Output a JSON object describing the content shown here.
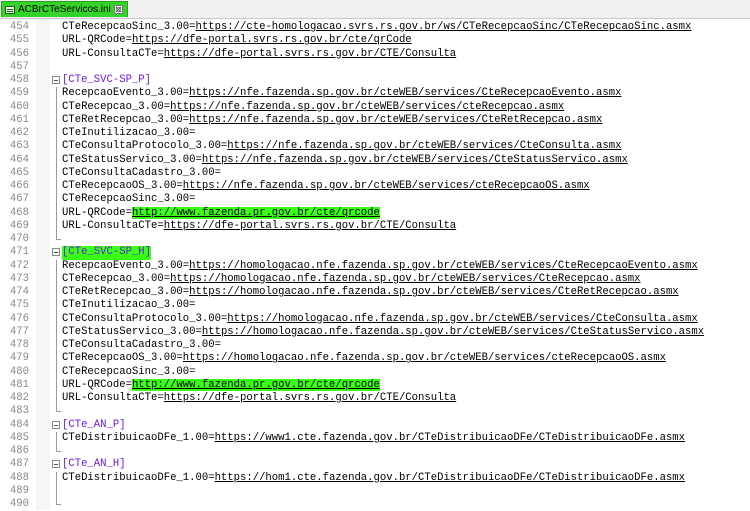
{
  "tab": {
    "title": "ACBrCTeServicos.ini",
    "close_glyph": "⊠"
  },
  "lines": [
    {
      "n": "454",
      "key": "CTeRecepcaoSinc_3.00=",
      "url": "https://cte-homologacao.svrs.rs.gov.br/ws/CTeRecepcaoSinc/CTeRecepcaoSinc.asmx"
    },
    {
      "n": "455",
      "key": "URL-QRCode=",
      "url": "https://dfe-portal.svrs.rs.gov.br/cte/qrCode"
    },
    {
      "n": "456",
      "key": "URL-ConsultaCTe=",
      "url": "https://dfe-portal.svrs.rs.gov.br/CTE/Consulta"
    },
    {
      "n": "457",
      "key": "",
      "url": ""
    },
    {
      "n": "458",
      "section": "[CTe_SVC-SP_P]",
      "fold": "start"
    },
    {
      "n": "459",
      "key": "RecepcaoEvento_3.00=",
      "url": "https://nfe.fazenda.sp.gov.br/cteWEB/services/CteRecepcaoEvento.asmx"
    },
    {
      "n": "460",
      "key": "CTeRecepcao_3.00=",
      "url": "https://nfe.fazenda.sp.gov.br/cteWEB/services/cteRecepcao.asmx"
    },
    {
      "n": "461",
      "key": "CTeRetRecepcao_3.00=",
      "url": "https://nfe.fazenda.sp.gov.br/cteWEB/services/CteRetRecepcao.asmx"
    },
    {
      "n": "462",
      "key": "CTeInutilizacao_3.00=",
      "url": ""
    },
    {
      "n": "463",
      "key": "CTeConsultaProtocolo_3.00=",
      "url": "https://nfe.fazenda.sp.gov.br/cteWEB/services/CteConsulta.asmx"
    },
    {
      "n": "464",
      "key": "CTeStatusServico_3.00=",
      "url": "https://nfe.fazenda.sp.gov.br/cteWEB/services/CteStatusServico.asmx"
    },
    {
      "n": "465",
      "key": "CTeConsultaCadastro_3.00=",
      "url": ""
    },
    {
      "n": "466",
      "key": "CTeRecepcaoOS_3.00=",
      "url": "https://nfe.fazenda.sp.gov.br/cteWEB/services/cteRecepcaoOS.asmx"
    },
    {
      "n": "467",
      "key": "CTeRecepcaoSinc_3.00=",
      "url": ""
    },
    {
      "n": "468",
      "key": "URL-QRCode=",
      "url": "http://www.fazenda.pr.gov.br/cte/qrcode",
      "highlight": true
    },
    {
      "n": "469",
      "key": "URL-ConsultaCTe=",
      "url": "https://dfe-portal.svrs.rs.gov.br/CTE/Consulta"
    },
    {
      "n": "470",
      "key": "",
      "url": ""
    },
    {
      "n": "471",
      "section": "[CTe_SVC-SP_H]",
      "fold": "start",
      "highlight_section": true
    },
    {
      "n": "472",
      "key": "RecepcaoEvento_3.00=",
      "url": "https://homologacao.nfe.fazenda.sp.gov.br/cteWEB/services/CteRecepcaoEvento.asmx"
    },
    {
      "n": "473",
      "key": "CTeRecepcao_3.00=",
      "url": "https://homologacao.nfe.fazenda.sp.gov.br/cteWEB/services/CteRecepcao.asmx"
    },
    {
      "n": "474",
      "key": "CTeRetRecepcao_3.00=",
      "url": "https://homologacao.nfe.fazenda.sp.gov.br/cteWEB/services/CteRetRecepcao.asmx"
    },
    {
      "n": "475",
      "key": "CTeInutilizacao_3.00=",
      "url": ""
    },
    {
      "n": "476",
      "key": "CTeConsultaProtocolo_3.00=",
      "url": "https://homologacao.nfe.fazenda.sp.gov.br/cteWEB/services/CteConsulta.asmx"
    },
    {
      "n": "477",
      "key": "CTeStatusServico_3.00=",
      "url": "https://homologacao.nfe.fazenda.sp.gov.br/cteWEB/services/CteStatusServico.asmx"
    },
    {
      "n": "478",
      "key": "CTeConsultaCadastro_3.00=",
      "url": ""
    },
    {
      "n": "479",
      "key": "CTeRecepcaoOS_3.00=",
      "url": "https://homologacao.nfe.fazenda.sp.gov.br/cteWEB/services/cteRecepcaoOS.asmx"
    },
    {
      "n": "480",
      "key": "CTeRecepcaoSinc_3.00=",
      "url": ""
    },
    {
      "n": "481",
      "key": "URL-QRCode=",
      "url": "http://www.fazenda.pr.gov.br/cte/qrcode",
      "highlight": true
    },
    {
      "n": "482",
      "key": "URL-ConsultaCTe=",
      "url": "https://dfe-portal.svrs.rs.gov.br/CTE/Consulta"
    },
    {
      "n": "483",
      "key": "",
      "url": ""
    },
    {
      "n": "484",
      "section": "[CTe_AN_P]",
      "fold": "start"
    },
    {
      "n": "485",
      "key": "CTeDistribuicaoDFe_1.00=",
      "url": "https://www1.cte.fazenda.gov.br/CTeDistribuicaoDFe/CTeDistribuicaoDFe.asmx"
    },
    {
      "n": "486",
      "key": "",
      "url": ""
    },
    {
      "n": "487",
      "section": "[CTe_AN_H]",
      "fold": "start"
    },
    {
      "n": "488",
      "key": "CTeDistribuicaoDFe_1.00=",
      "url": "https://hom1.cte.fazenda.gov.br/CTeDistribuicaoDFe/CTeDistribuicaoDFe.asmx"
    },
    {
      "n": "489",
      "key": "",
      "url": ""
    },
    {
      "n": "490",
      "key": "",
      "url": ""
    }
  ]
}
